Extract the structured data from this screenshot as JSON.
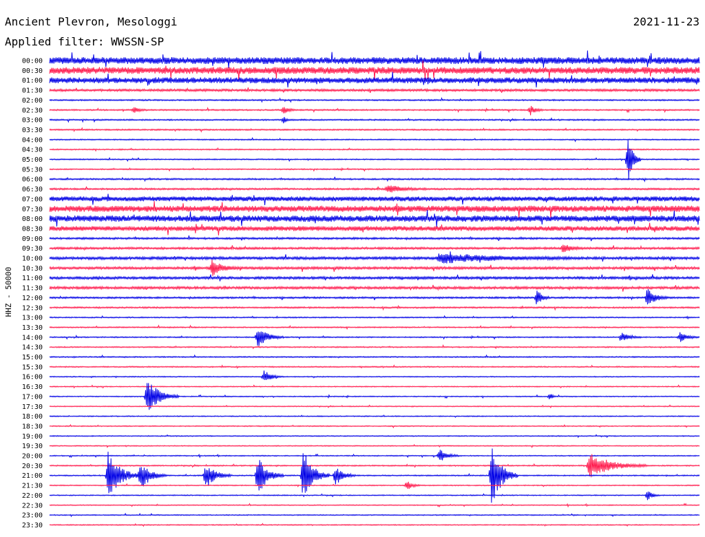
{
  "header": {
    "station": "Ancient Plevron, Mesologgi",
    "date": "2021-11-23",
    "filter": "Applied filter: WWSSN-SP"
  },
  "chart_data": {
    "type": "line",
    "title": "Ancient Plevron, Mesologgi",
    "subtitle": "Applied filter: WWSSN-SP",
    "date": "2021-11-23",
    "ylabel": "HHZ - 50000",
    "colors": [
      "#0000e6",
      "#ff1a4d"
    ],
    "row_labels": [
      "00:00",
      "00:30",
      "01:00",
      "01:30",
      "02:00",
      "02:30",
      "03:00",
      "03:30",
      "04:00",
      "04:30",
      "05:00",
      "05:30",
      "06:00",
      "06:30",
      "07:00",
      "07:30",
      "08:00",
      "08:30",
      "09:00",
      "09:30",
      "10:00",
      "10:30",
      "11:00",
      "11:30",
      "12:00",
      "12:30",
      "13:00",
      "13:30",
      "14:00",
      "14:30",
      "15:00",
      "15:30",
      "16:00",
      "16:30",
      "17:00",
      "17:30",
      "18:00",
      "18:30",
      "19:00",
      "19:30",
      "20:00",
      "20:30",
      "21:00",
      "21:30",
      "22:00",
      "22:30",
      "23:00",
      "23:30"
    ],
    "noise_level": [
      3.5,
      3.5,
      3.0,
      1.2,
      0.7,
      0.7,
      0.7,
      0.7,
      0.6,
      0.6,
      0.6,
      0.6,
      0.8,
      0.9,
      2.5,
      3.2,
      3.2,
      2.5,
      1.0,
      1.1,
      1.4,
      1.3,
      1.3,
      1.3,
      0.9,
      0.8,
      0.6,
      0.6,
      0.6,
      0.6,
      0.6,
      0.6,
      0.5,
      0.5,
      0.5,
      0.5,
      0.5,
      0.5,
      0.5,
      0.5,
      0.5,
      0.6,
      0.6,
      0.5,
      0.5,
      0.5,
      0.5,
      0.5
    ],
    "events": [
      {
        "row": 5,
        "t": 0.13,
        "amp": 4,
        "dur": 0.02
      },
      {
        "row": 5,
        "t": 0.36,
        "amp": 5,
        "dur": 0.02
      },
      {
        "row": 5,
        "t": 0.74,
        "amp": 6,
        "dur": 0.02
      },
      {
        "row": 6,
        "t": 0.36,
        "amp": 4,
        "dur": 0.01
      },
      {
        "row": 10,
        "t": 0.89,
        "amp": 32,
        "dur": 0.02
      },
      {
        "row": 13,
        "t": 0.52,
        "amp": 5,
        "dur": 0.06
      },
      {
        "row": 19,
        "t": 0.79,
        "amp": 6,
        "dur": 0.03
      },
      {
        "row": 20,
        "t": 0.6,
        "amp": 6,
        "dur": 0.2
      },
      {
        "row": 21,
        "t": 0.25,
        "amp": 10,
        "dur": 0.04
      },
      {
        "row": 24,
        "t": 0.92,
        "amp": 12,
        "dur": 0.03
      },
      {
        "row": 24,
        "t": 0.75,
        "amp": 10,
        "dur": 0.02
      },
      {
        "row": 28,
        "t": 0.32,
        "amp": 14,
        "dur": 0.04
      },
      {
        "row": 28,
        "t": 0.88,
        "amp": 6,
        "dur": 0.03
      },
      {
        "row": 28,
        "t": 0.97,
        "amp": 6,
        "dur": 0.03
      },
      {
        "row": 32,
        "t": 0.33,
        "amp": 8,
        "dur": 0.03
      },
      {
        "row": 34,
        "t": 0.15,
        "amp": 22,
        "dur": 0.05
      },
      {
        "row": 34,
        "t": 0.77,
        "amp": 5,
        "dur": 0.01
      },
      {
        "row": 40,
        "t": 0.6,
        "amp": 9,
        "dur": 0.03
      },
      {
        "row": 41,
        "t": 0.83,
        "amp": 16,
        "dur": 0.09
      },
      {
        "row": 42,
        "t": 0.09,
        "amp": 30,
        "dur": 0.05
      },
      {
        "row": 42,
        "t": 0.14,
        "amp": 18,
        "dur": 0.04
      },
      {
        "row": 42,
        "t": 0.24,
        "amp": 16,
        "dur": 0.04
      },
      {
        "row": 42,
        "t": 0.32,
        "amp": 25,
        "dur": 0.04
      },
      {
        "row": 42,
        "t": 0.39,
        "amp": 34,
        "dur": 0.04
      },
      {
        "row": 42,
        "t": 0.44,
        "amp": 14,
        "dur": 0.03
      },
      {
        "row": 42,
        "t": 0.68,
        "amp": 40,
        "dur": 0.04
      },
      {
        "row": 43,
        "t": 0.55,
        "amp": 6,
        "dur": 0.02
      },
      {
        "row": 44,
        "t": 0.92,
        "amp": 6,
        "dur": 0.02
      }
    ]
  }
}
